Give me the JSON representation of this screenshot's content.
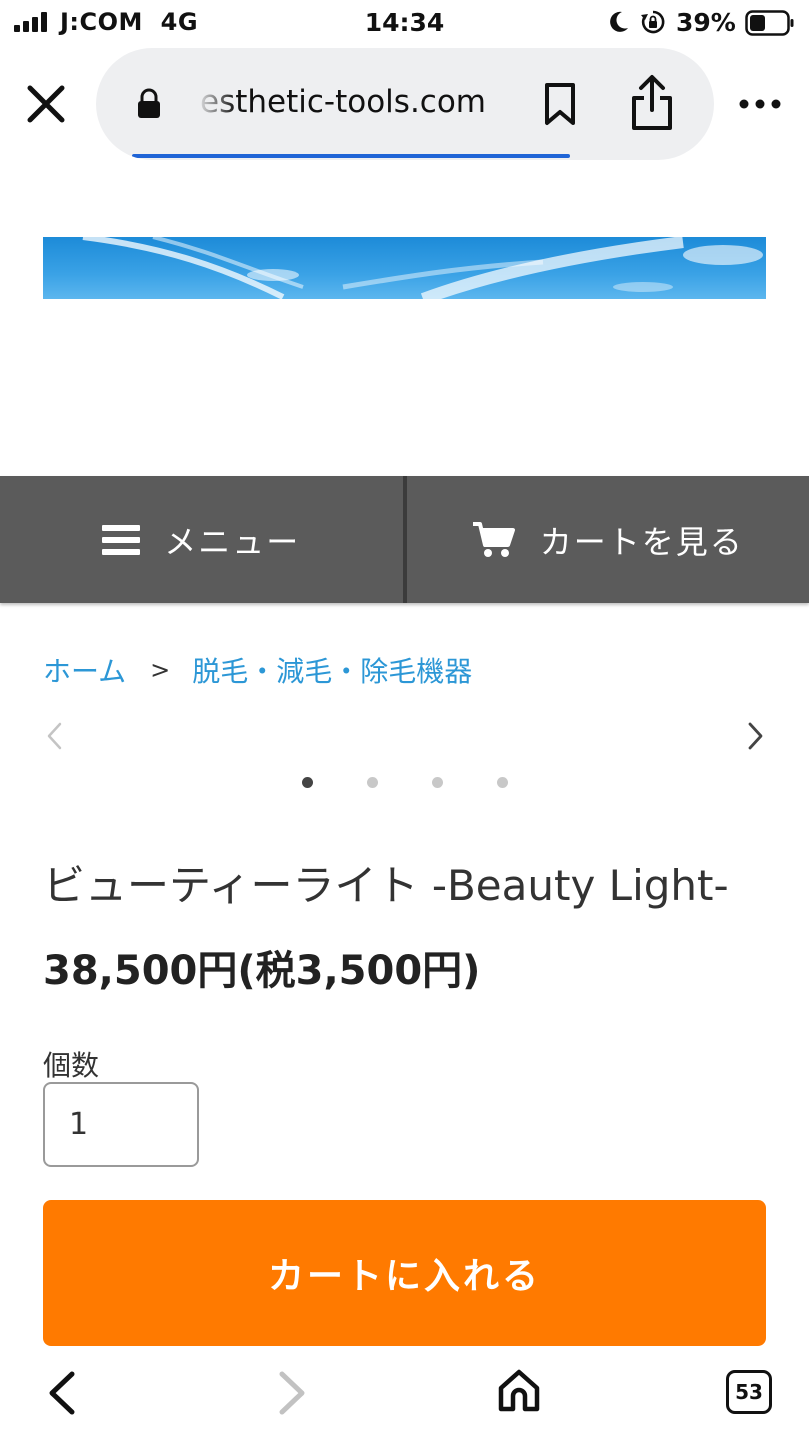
{
  "status_bar": {
    "carrier": "J:COM  4G",
    "time": "14:34",
    "battery_percent": "39%"
  },
  "browser": {
    "url": "esthetic-tools.com",
    "tab_count": "53",
    "load_progress": 0.7
  },
  "nav": {
    "menu_label": "メニュー",
    "cart_label": "カートを見る"
  },
  "breadcrumb": {
    "home": "ホーム",
    "separator": ">",
    "category": "脱毛・減毛・除毛機器"
  },
  "carousel": {
    "slide_count": 4,
    "active_index": 0
  },
  "product": {
    "title": "ビューティーライト -Beauty Light-",
    "price": "38,500円(税3,500円)",
    "quantity_label": "個数",
    "quantity_value": "1",
    "add_to_cart_label": "カートに入れる"
  },
  "colors": {
    "accent_orange": "#ff7a00",
    "nav_bg": "#5b5b5b",
    "link_blue": "#2c97d6",
    "progress_blue": "#1f64d6"
  }
}
